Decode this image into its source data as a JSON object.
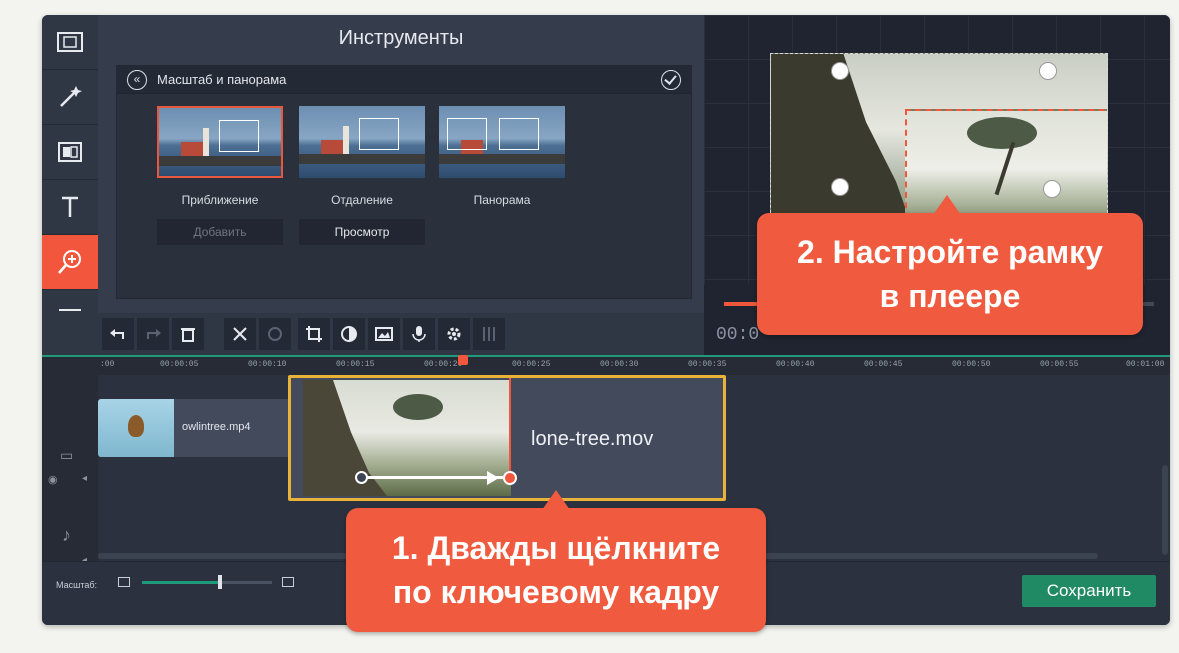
{
  "tools_panel": {
    "title": "Инструменты",
    "section_title": "Масштаб и панорама",
    "presets": [
      {
        "label": "Приближение"
      },
      {
        "label": "Отдаление"
      },
      {
        "label": "Панорама"
      }
    ],
    "add_button": "Добавить",
    "preview_button": "Просмотр"
  },
  "player": {
    "timecode": "00:0"
  },
  "timeline": {
    "ruler_ticks": [
      ":00",
      "00:00:05",
      "00:00:10",
      "00:00:15",
      "00:00:20",
      "00:00:25",
      "00:00:30",
      "00:00:35",
      "00:00:40",
      "00:00:45",
      "00:00:50",
      "00:00:55",
      "00:01:00"
    ],
    "clips": [
      {
        "label": "owlintree.mp4"
      },
      {
        "label": "lone-tree.mov"
      }
    ]
  },
  "bottom_bar": {
    "scale_label": "Масштаб:",
    "scale_level": 0.6,
    "save_button": "Сохранить"
  },
  "callouts": {
    "step1_line1": "1. Дважды щёлкните",
    "step1_line2": "по ключевому кадру",
    "step2_line1": "2. Настройте рамку",
    "step2_line2": "в плеере"
  },
  "colors": {
    "accent": "#f2563c",
    "save_button": "#1f8a63",
    "clip_selected_border": "#e9b33a"
  }
}
